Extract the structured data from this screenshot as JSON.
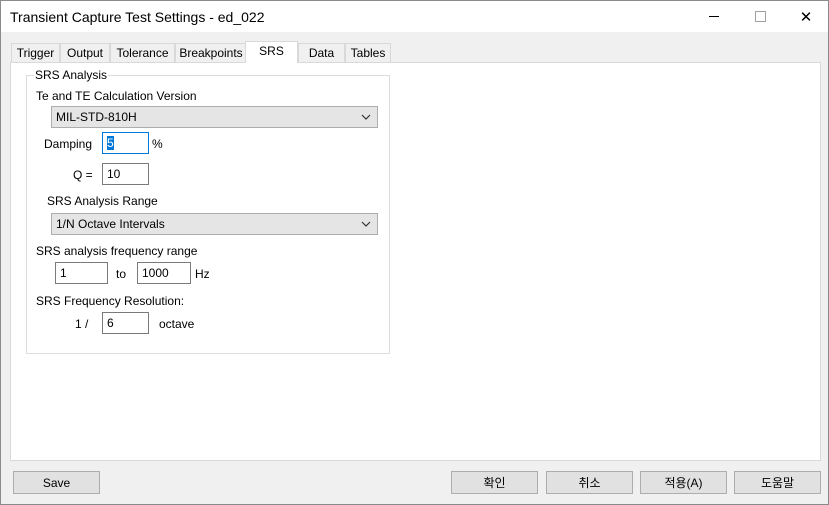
{
  "window": {
    "title": "Transient Capture Test Settings - ed_022",
    "controls": {
      "minimize_icon": "minimize-icon",
      "maximize_icon": "maximize-icon",
      "close_icon": "close-icon",
      "close_glyph": "✕"
    }
  },
  "tabs": [
    {
      "label": "Trigger",
      "active": false
    },
    {
      "label": "Output",
      "active": false
    },
    {
      "label": "Tolerance",
      "active": false
    },
    {
      "label": "Breakpoints",
      "active": false
    },
    {
      "label": "SRS",
      "active": true
    },
    {
      "label": "Data",
      "active": false
    },
    {
      "label": "Tables",
      "active": false
    }
  ],
  "srs": {
    "group_title": "SRS Analysis",
    "te_label": "Te and TE Calculation Version",
    "te_value": "MIL-STD-810H",
    "damping_label": "Damping",
    "damping_value": "5",
    "damping_unit": "%",
    "q_label": "Q =",
    "q_value": "10",
    "range_label": "SRS Analysis Range",
    "range_value": "1/N Octave Intervals",
    "freq_range_label": "SRS analysis frequency range",
    "freq_from": "1",
    "freq_to_label": "to",
    "freq_to": "1000",
    "freq_unit": "Hz",
    "resolution_label": "SRS Frequency Resolution:",
    "resolution_prefix": "1 /",
    "resolution_value": "6",
    "resolution_unit": "octave"
  },
  "buttons": {
    "save": "Save",
    "ok": "확인",
    "cancel": "취소",
    "apply": "적용(A)",
    "help": "도움말"
  }
}
